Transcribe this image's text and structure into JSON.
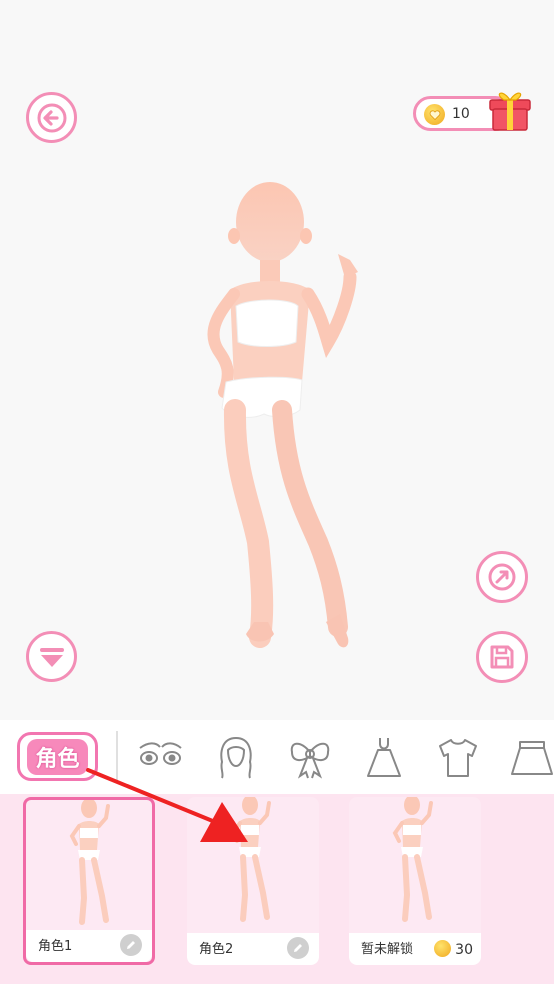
{
  "coins": {
    "count": "10"
  },
  "tabs": {
    "active_label": "角色",
    "others": [
      "eyes-icon",
      "hair-icon",
      "bow-icon",
      "dress-icon",
      "tshirt-icon",
      "skirt-icon"
    ]
  },
  "cards": [
    {
      "label": "角色1",
      "action": "edit-icon",
      "selected": true
    },
    {
      "label": "角色2",
      "action": "edit-icon",
      "selected": false
    },
    {
      "label": "暂未解锁",
      "price": "30",
      "selected": false
    }
  ],
  "colors": {
    "accent": "#f38eb6",
    "tab_active_fill": "#f789bb",
    "card_bg": "#fde9f3",
    "area_bg": "#fde4f0",
    "arrow": "#ee2222"
  }
}
